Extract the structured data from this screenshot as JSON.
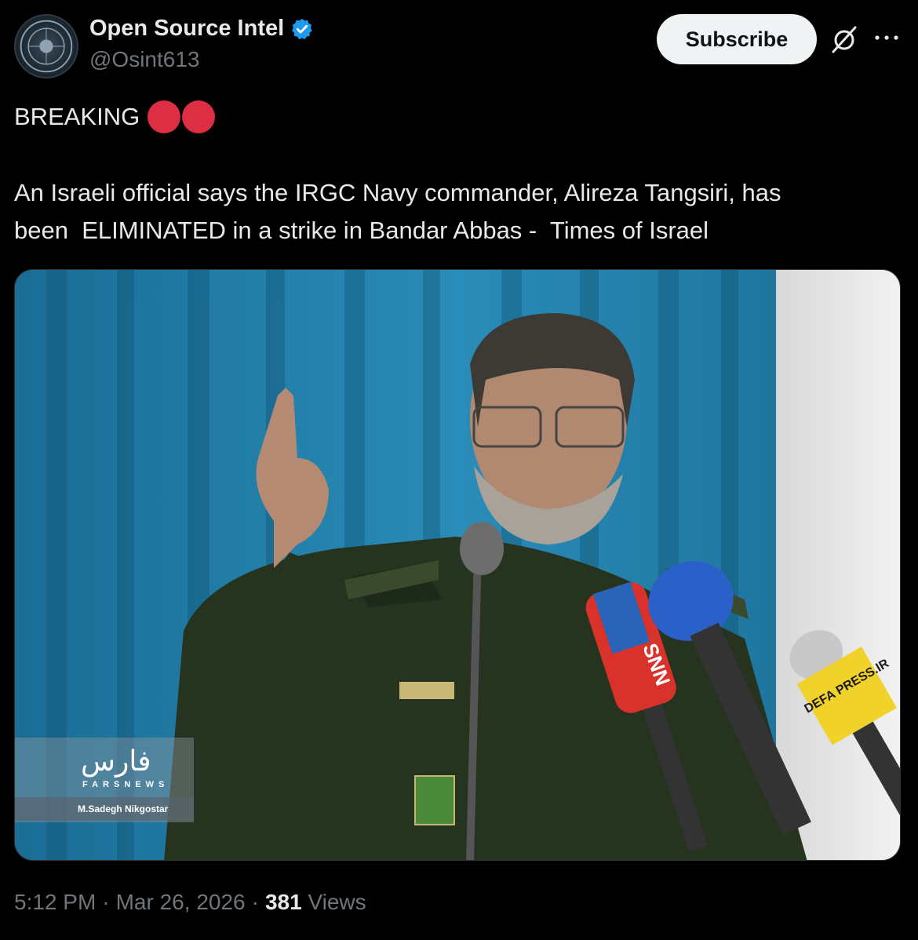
{
  "author": {
    "display_name": "Open Source Intel",
    "handle": "@Osint613",
    "verified": true,
    "avatar_icon": "osint-seal-avatar"
  },
  "actions": {
    "subscribe_label": "Subscribe",
    "grok_icon": "grok-slash-icon",
    "more_icon": "more-horizontal-icon"
  },
  "tweet": {
    "breaking_label": "BREAKING",
    "breaking_emoji": "red-circle-emoji x2",
    "text": "An Israeli official says the IRGC Navy commander, Alireza Tangsiri, has\nbeen  ELIMINATED in a strike in Bandar Abbas -  Times of Israel"
  },
  "media": {
    "watermark_logo": "فارس",
    "watermark_agency": "FARSNEWS",
    "photo_credit": "M.Sadegh Nikgostar",
    "mic_label_1": "SNN",
    "mic_label_2": "DEFA PRESS.IR"
  },
  "footer": {
    "time": "5:12 PM",
    "separator": "·",
    "date": "Mar 26, 2026",
    "views_count": "381",
    "views_label": "Views"
  },
  "colors": {
    "background": "#000000",
    "text_primary": "#e7e9ea",
    "text_secondary": "#71767b",
    "verified_blue": "#1d9bf0",
    "red_dot": "#dd2e44",
    "subscribe_bg": "#eff3f4"
  }
}
